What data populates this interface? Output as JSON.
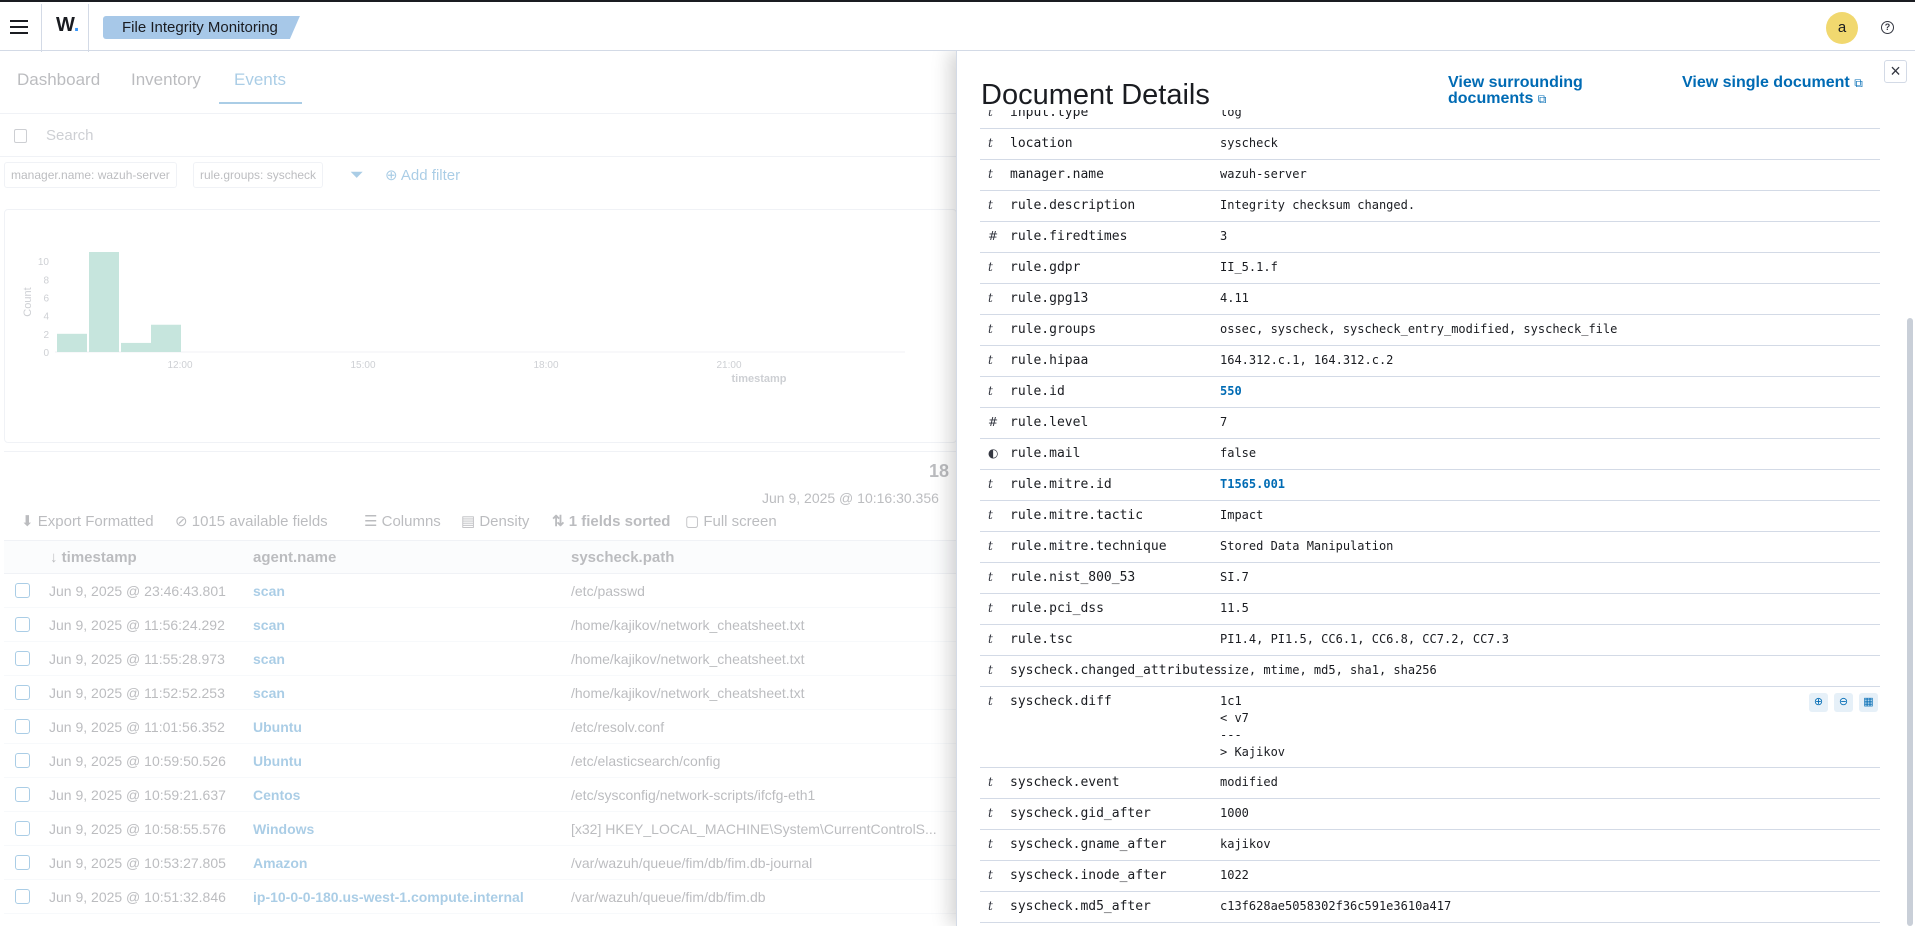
{
  "topbar": {
    "logo": "W",
    "logo_dot": ".",
    "breadcrumb": "File Integrity Monitoring",
    "avatar_initial": "a",
    "help": "?"
  },
  "tabs": [
    "Dashboard",
    "Inventory",
    "Events"
  ],
  "search": {
    "placeholder": "Search"
  },
  "filters": [
    "manager.name: wazuh-server",
    "rule.groups: syscheck"
  ],
  "add_filter_label": "Add filter",
  "chart_data": {
    "type": "bar",
    "ylabel": "Count",
    "xlabel": "timestamp",
    "yticks": [
      "10",
      "8",
      "6",
      "4",
      "2",
      "0"
    ],
    "xticks": [
      "12:00",
      "15:00",
      "18:00",
      "21:00"
    ],
    "values": [
      2,
      11,
      1,
      3
    ],
    "ylim": [
      0,
      11
    ]
  },
  "table": {
    "hits": "18",
    "range": "Jun 9, 2025 @ 10:16:30.356",
    "toolbar": {
      "export": "Export Formatted",
      "fields": "1015 available fields",
      "columns": "Columns",
      "density": "Density",
      "sorted": "1 fields sorted",
      "fullscreen": "Full screen"
    },
    "columns": [
      "timestamp",
      "agent.name",
      "syscheck.path"
    ],
    "rows": [
      {
        "timestamp": "Jun 9, 2025 @ 23:46:43.801",
        "agent": "scan",
        "path": "/etc/passwd"
      },
      {
        "timestamp": "Jun 9, 2025 @ 11:56:24.292",
        "agent": "scan",
        "path": "/home/kajikov/network_cheatsheet.txt"
      },
      {
        "timestamp": "Jun 9, 2025 @ 11:55:28.973",
        "agent": "scan",
        "path": "/home/kajikov/network_cheatsheet.txt"
      },
      {
        "timestamp": "Jun 9, 2025 @ 11:52:52.253",
        "agent": "scan",
        "path": "/home/kajikov/network_cheatsheet.txt"
      },
      {
        "timestamp": "Jun 9, 2025 @ 11:01:56.352",
        "agent": "Ubuntu",
        "path": "/etc/resolv.conf"
      },
      {
        "timestamp": "Jun 9, 2025 @ 10:59:50.526",
        "agent": "Ubuntu",
        "path": "/etc/elasticsearch/config"
      },
      {
        "timestamp": "Jun 9, 2025 @ 10:59:21.637",
        "agent": "Centos",
        "path": "/etc/sysconfig/network-scripts/ifcfg-eth1"
      },
      {
        "timestamp": "Jun 9, 2025 @ 10:58:55.576",
        "agent": "Windows",
        "path": "[x32] HKEY_LOCAL_MACHINE\\System\\CurrentControlS..."
      },
      {
        "timestamp": "Jun 9, 2025 @ 10:53:27.805",
        "agent": "Amazon",
        "path": "/var/wazuh/queue/fim/db/fim.db-journal"
      },
      {
        "timestamp": "Jun 9, 2025 @ 10:51:32.846",
        "agent": "ip-10-0-0-180.us-west-1.compute.internal",
        "path": "/var/wazuh/queue/fim/db/fim.db"
      }
    ]
  },
  "flyout": {
    "title": "Document Details",
    "view_surrounding": "View surrounding documents",
    "view_single": "View single document",
    "close": "×",
    "fields": [
      {
        "type": "t",
        "name": "input.type",
        "value": "log"
      },
      {
        "type": "t",
        "name": "location",
        "value": "syscheck"
      },
      {
        "type": "t",
        "name": "manager.name",
        "value": "wazuh-server"
      },
      {
        "type": "t",
        "name": "rule.description",
        "value": "Integrity checksum changed."
      },
      {
        "type": "#",
        "name": "rule.firedtimes",
        "value": "3"
      },
      {
        "type": "t",
        "name": "rule.gdpr",
        "value": "II_5.1.f"
      },
      {
        "type": "t",
        "name": "rule.gpg13",
        "value": "4.11"
      },
      {
        "type": "t",
        "name": "rule.groups",
        "value": "ossec, syscheck, syscheck_entry_modified, syscheck_file"
      },
      {
        "type": "t",
        "name": "rule.hipaa",
        "value": "164.312.c.1, 164.312.c.2"
      },
      {
        "type": "t",
        "name": "rule.id",
        "value": "550",
        "link": true
      },
      {
        "type": "#",
        "name": "rule.level",
        "value": "7"
      },
      {
        "type": "◐",
        "name": "rule.mail",
        "value": "false"
      },
      {
        "type": "t",
        "name": "rule.mitre.id",
        "value": "T1565.001",
        "link": true
      },
      {
        "type": "t",
        "name": "rule.mitre.tactic",
        "value": "Impact"
      },
      {
        "type": "t",
        "name": "rule.mitre.technique",
        "value": "Stored Data Manipulation"
      },
      {
        "type": "t",
        "name": "rule.nist_800_53",
        "value": "SI.7"
      },
      {
        "type": "t",
        "name": "rule.pci_dss",
        "value": "11.5"
      },
      {
        "type": "t",
        "name": "rule.tsc",
        "value": "PI1.4, PI1.5, CC6.1, CC6.8, CC7.2, CC7.3"
      },
      {
        "type": "t",
        "name": "syscheck.changed_attributes",
        "value": "size, mtime, md5, sha1, sha256"
      },
      {
        "type": "t",
        "name": "syscheck.diff",
        "value": "1c1\n< v7\n---\n> Kajikov",
        "actions": true
      },
      {
        "type": "t",
        "name": "syscheck.event",
        "value": "modified"
      },
      {
        "type": "t",
        "name": "syscheck.gid_after",
        "value": "1000"
      },
      {
        "type": "t",
        "name": "syscheck.gname_after",
        "value": "kajikov"
      },
      {
        "type": "t",
        "name": "syscheck.inode_after",
        "value": "1022"
      },
      {
        "type": "t",
        "name": "syscheck.md5_after",
        "value": "c13f628ae5058302f36c591e3610a417"
      }
    ]
  }
}
